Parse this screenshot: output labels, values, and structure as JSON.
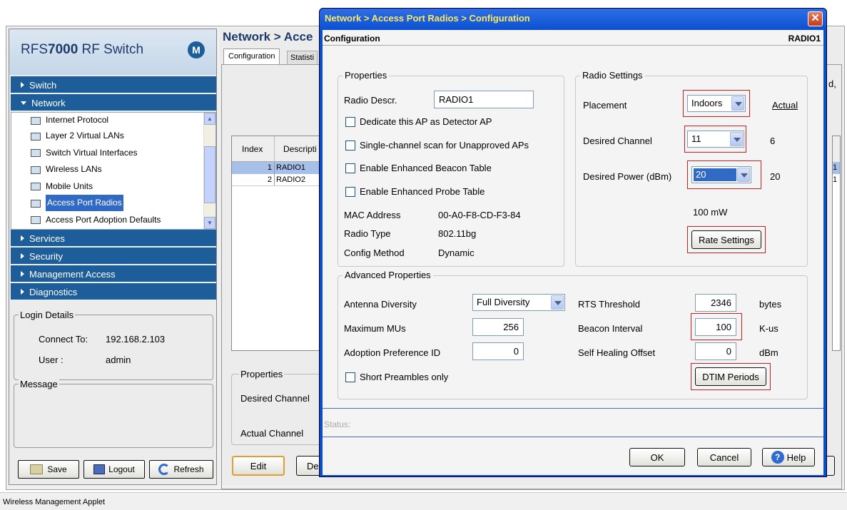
{
  "app": {
    "title": "RFS7000 RF Switch",
    "title_parts": {
      "prefix": "RFS",
      "model": "7000",
      "suffix": " RF Switch"
    },
    "logo_glyph": "M"
  },
  "sidebar": {
    "sections": [
      {
        "label": "Switch"
      },
      {
        "label": "Network"
      },
      {
        "label": "Services"
      },
      {
        "label": "Security"
      },
      {
        "label": "Management Access"
      },
      {
        "label": "Diagnostics"
      }
    ],
    "tree": [
      {
        "label": "Internet Protocol"
      },
      {
        "label": "Layer 2 Virtual LANs"
      },
      {
        "label": "Switch Virtual Interfaces"
      },
      {
        "label": "Wireless LANs"
      },
      {
        "label": "Mobile Units"
      },
      {
        "label": "Access Port Radios"
      },
      {
        "label": "Access Port Adoption Defaults"
      }
    ]
  },
  "login": {
    "legend": "Login Details",
    "connect_label": "Connect To:",
    "connect_value": "192.168.2.103",
    "user_label": "User :",
    "user_value": "admin"
  },
  "message": {
    "legend": "Message"
  },
  "bottom_buttons": {
    "save": "Save",
    "logout": "Logout",
    "refresh": "Refresh"
  },
  "main": {
    "title": "Network > Acce",
    "tabs": [
      "Configuration",
      "Statisti"
    ],
    "table_headers": [
      "Index",
      "Descripti"
    ],
    "rows": [
      {
        "index": "1",
        "desc": "RADIO1"
      },
      {
        "index": "2",
        "desc": "RADIO2"
      }
    ],
    "right_clip_text": "d,",
    "right_cells": [
      "1",
      "1"
    ],
    "properties_legend": "Properties",
    "desired_channel_label": "Desired Channel",
    "actual_channel_label": "Actual Channel",
    "edit_button": "Edit",
    "de_button": "De"
  },
  "dialog": {
    "titlebar": "Network > Access Port Radios > Configuration",
    "header_left": "Configuration",
    "header_right": "RADIO1",
    "properties": {
      "legend": "Properties",
      "radio_descr_label": "Radio Descr.",
      "radio_descr_value": "RADIO1",
      "checkboxes": [
        "Dedicate this AP as Detector AP",
        "Single-channel scan for Unapproved APs",
        "Enable Enhanced Beacon Table",
        "Enable Enhanced Probe Table"
      ],
      "mac_label": "MAC Address",
      "mac_value": "00-A0-F8-CD-F3-84",
      "radio_type_label": "Radio Type",
      "radio_type_value": "802.11bg",
      "config_method_label": "Config Method",
      "config_method_value": "Dynamic"
    },
    "radio_settings": {
      "legend": "Radio Settings",
      "placement_label": "Placement",
      "placement_value": "Indoors",
      "actual_label": "Actual",
      "channel_label": "Desired Channel",
      "channel_value": "11",
      "channel_actual": "6",
      "power_label": "Desired Power (dBm)",
      "power_value": "20",
      "power_actual": "20",
      "power_mw": "100 mW",
      "rate_button": "Rate Settings"
    },
    "advanced": {
      "legend": "Advanced Properties",
      "antenna_label": "Antenna Diversity",
      "antenna_value": "Full Diversity",
      "max_mus_label": "Maximum MUs",
      "max_mus_value": "256",
      "adoption_label": "Adoption Preference ID",
      "adoption_value": "0",
      "short_preambles": "Short Preambles only",
      "rts_label": "RTS Threshold",
      "rts_value": "2346",
      "rts_unit": "bytes",
      "beacon_label": "Beacon Interval",
      "beacon_value": "100",
      "beacon_unit": "K-us",
      "healing_label": "Self Healing Offset",
      "healing_value": "0",
      "healing_unit": "dBm",
      "dtim_button": "DTIM Periods"
    },
    "status_label": "Status:",
    "ok_button": "OK",
    "cancel_button": "Cancel",
    "help_button": "Help"
  },
  "statusbar": {
    "text": "Wireless Management Applet"
  },
  "colors": {
    "sidebar_blue": "#1d5e9a",
    "dialog_border": "#0b4fc7",
    "title_orange": "#ffe85a",
    "highlight_red": "#d02020",
    "selection_blue": "#316ac5"
  }
}
